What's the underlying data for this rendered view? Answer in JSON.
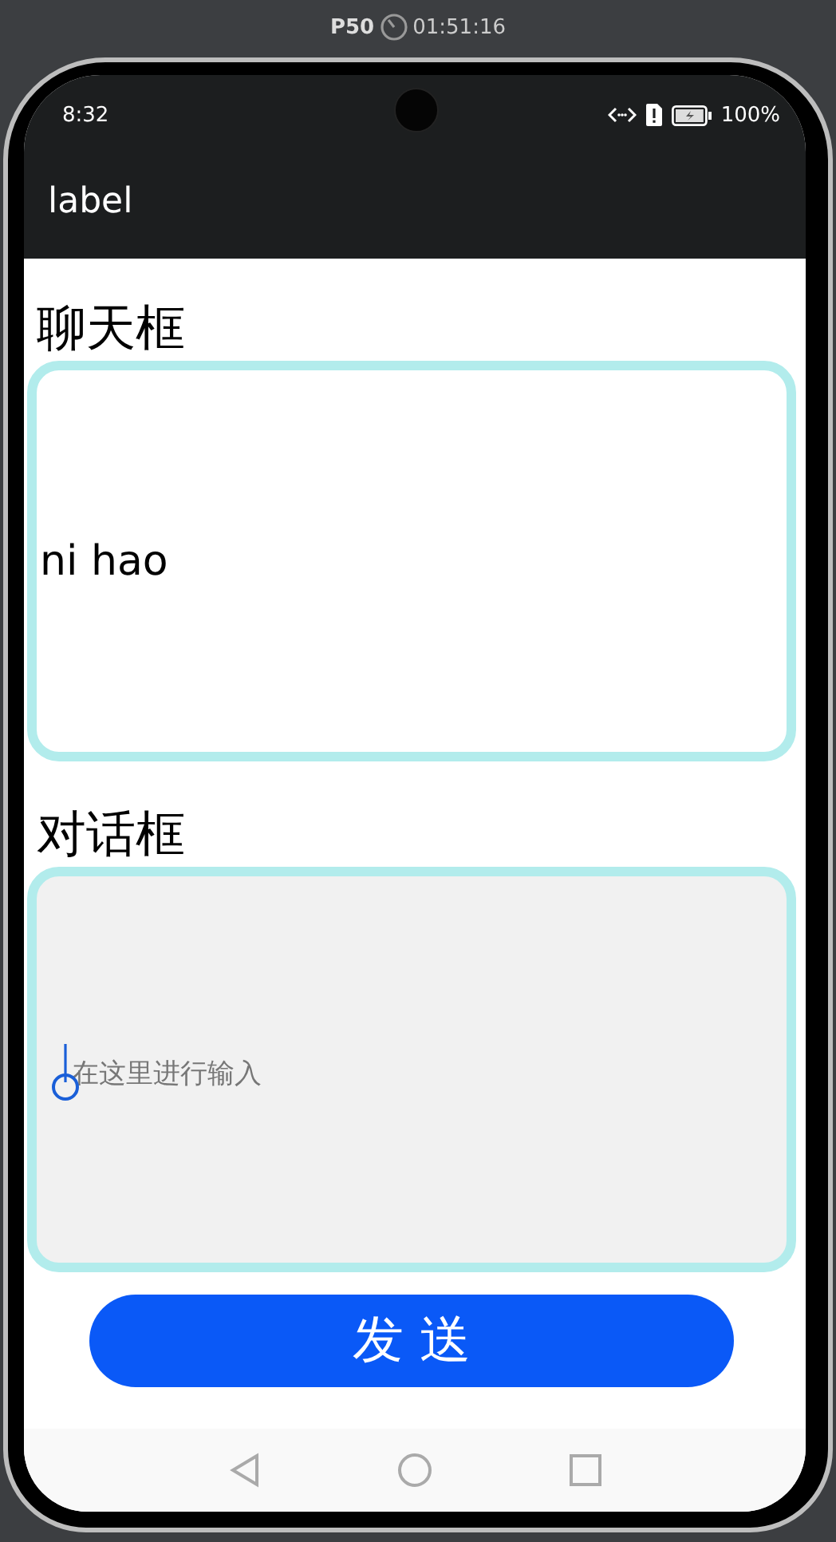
{
  "emulator_bar": {
    "device": "P50",
    "timer": "01:51:16"
  },
  "status_bar": {
    "time": "8:32",
    "battery": "100%"
  },
  "app_bar": {
    "title": "label"
  },
  "chat_section": {
    "heading": "聊天框",
    "message": "ni hao"
  },
  "input_section": {
    "heading": "对话框",
    "placeholder": "在这里进行输入"
  },
  "send_button": {
    "label": "发 送"
  }
}
